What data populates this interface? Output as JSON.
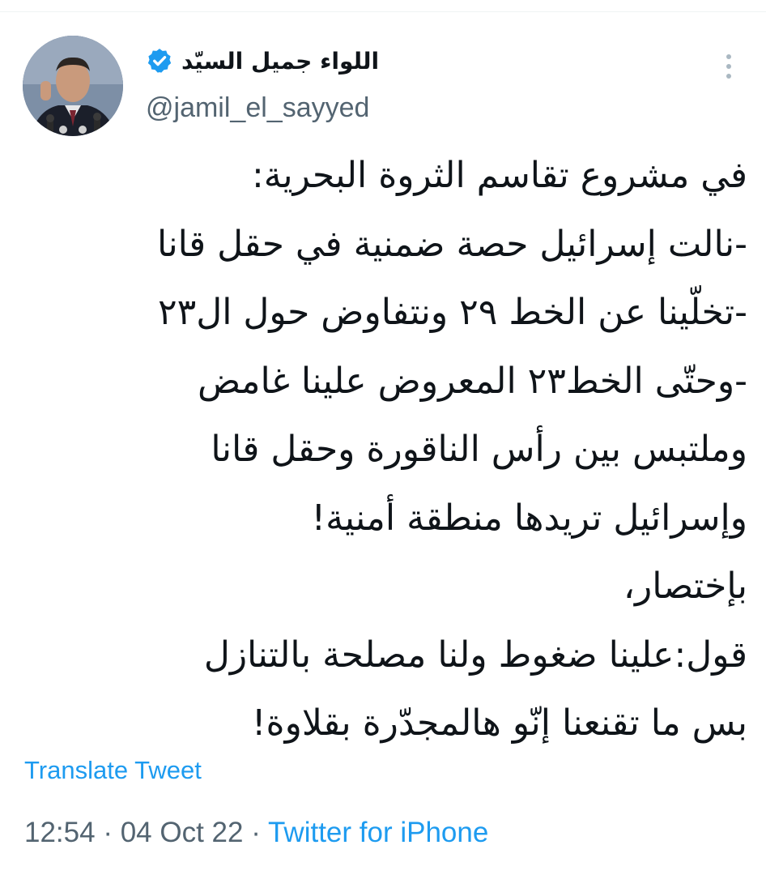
{
  "tweet": {
    "author": {
      "display_name": "اللواء جميل السيّد",
      "handle": "@jamil_el_sayyed",
      "verified": true,
      "verified_color": "#1d9bf0"
    },
    "lines": [
      "في مشروع تقاسم الثروة البحرية:",
      "-نالت إسرائيل حصة ضمنية في حقل قانا",
      "-تخلّينا عن الخط ٢٩ ونتفاوض حول ال٢٣",
      "-وحتّى الخط٢٣ المعروض علينا غامض",
      "وملتبس بين رأس الناقورة وحقل قانا",
      "وإسرائيل تريدها منطقة أمنية!",
      "بإختصار،",
      "قول:علينا ضغوط ولنا مصلحة بالتنازل",
      "بس ما تقنعنا إنّو هالمجدّرة بقلاوة!"
    ],
    "translate_label": "Translate Tweet",
    "time": "12:54",
    "date": "04 Oct 22",
    "separator": "·",
    "source": "Twitter for iPhone"
  },
  "icons": {
    "verified": "verified-badge-icon",
    "more": "more-vertical-icon",
    "avatar": "profile-photo"
  },
  "colors": {
    "link": "#1d9bf0",
    "text": "#0f1419",
    "secondary": "#536471"
  }
}
